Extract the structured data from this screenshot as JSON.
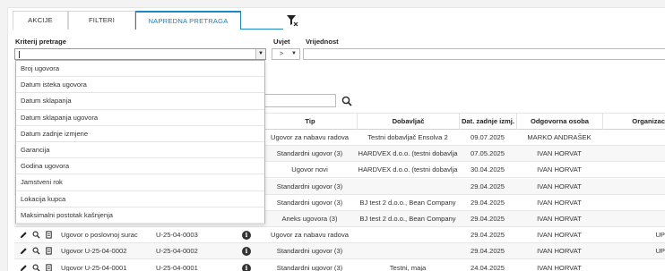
{
  "tabs": [
    {
      "label": "AKCIJE",
      "active": false
    },
    {
      "label": "FILTERI",
      "active": false
    },
    {
      "label": "NAPREDNA PRETRAGA",
      "active": true
    }
  ],
  "criteria": {
    "label": "Kriterij pretrage",
    "value": "",
    "options": [
      "Broj ugovora",
      "Datum isteka ugovora",
      "Datum sklapanja",
      "Datum sklapanja ugovora",
      "Datum zadnje izmjene",
      "Garancija",
      "Godina ugovora",
      "Jamstveni rok",
      "Lokacija kupca",
      "Maksimalni postotak kašnjenja"
    ]
  },
  "condition": {
    "label": "Uvjet",
    "value": ">"
  },
  "value_field": {
    "label": "Vrijednost",
    "value": ""
  },
  "table": {
    "headers": {
      "tip": "Tip",
      "dobavljac": "Dobavljač",
      "datum": "Dat. zadnje izmj.",
      "osoba": "Odgovorna osoba",
      "org": "Organizac"
    },
    "rows": [
      {
        "name": "",
        "number": "",
        "tip": "Ugovor za nabavu radova",
        "dobavljac": "Testni dobavljač Ensolva 2",
        "datum": "09.07.2025",
        "osoba": "MARKO ANDRAŠEK",
        "org": ""
      },
      {
        "name": "",
        "number": "",
        "tip": "Standardni ugovor (3)",
        "dobavljac": "HARDVEX d.o.o. (testni dobavlja",
        "datum": "07.05.2025",
        "osoba": "IVAN HORVAT",
        "org": ""
      },
      {
        "name": "",
        "number": "",
        "tip": "Ugovor novi",
        "dobavljac": "HARDVEX d.o.o. (testni dobavlja",
        "datum": "30.04.2025",
        "osoba": "IVAN HORVAT",
        "org": ""
      },
      {
        "name": "",
        "number": "",
        "tip": "Standardni ugovor (3)",
        "dobavljac": "",
        "datum": "29.04.2025",
        "osoba": "IVAN HORVAT",
        "org": ""
      },
      {
        "name": "",
        "number": "",
        "tip": "Standardni ugovor (3)",
        "dobavljac": "BJ test 2 d.o.o., Bean Company",
        "datum": "29.04.2025",
        "osoba": "IVAN HORVAT",
        "org": ""
      },
      {
        "name": "",
        "number": "",
        "tip": "Aneks ugovora (3)",
        "dobavljac": "BJ test 2 d.o.o., Bean Company",
        "datum": "29.04.2025",
        "osoba": "IVAN HORVAT",
        "org": ""
      },
      {
        "name": "Ugovor o poslovnoj surac",
        "number": "U-25-04-0003",
        "tip": "Ugovor za nabavu radova",
        "dobavljac": "",
        "datum": "29.04.2025",
        "osoba": "IVAN HORVAT",
        "org": "UP"
      },
      {
        "name": "Ugovor U-25-04-0002",
        "number": "U-25-04-0002",
        "tip": "Standardni ugovor (3)",
        "dobavljac": "",
        "datum": "29.04.2025",
        "osoba": "IVAN HORVAT",
        "org": "UP"
      },
      {
        "name": "Ugovor U-25-04-0001",
        "number": "U-25-04-0001",
        "tip": "Standardni ugovor (3)",
        "dobavljac": "Testni, maja",
        "datum": "24.04.2025",
        "osoba": "IVAN HORVAT",
        "org": ""
      }
    ]
  },
  "colors": {
    "accent": "#1e88c7",
    "border": "#d6d6d6"
  }
}
